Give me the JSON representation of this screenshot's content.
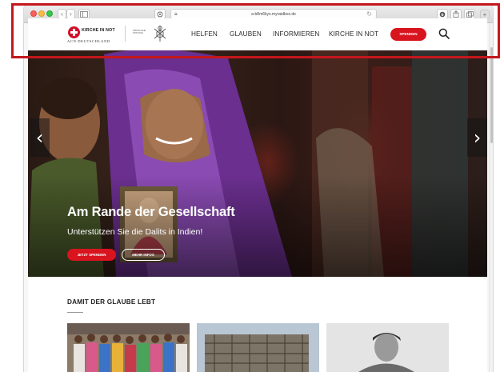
{
  "browser": {
    "address_url": "a-b8m6kys.myraidbox.de",
    "icons": [
      "back-icon",
      "forward-icon",
      "sidebar-icon",
      "privacy-icon",
      "reload-icon",
      "download-icon",
      "share-icon",
      "tabs-icon",
      "add-tab-icon"
    ]
  },
  "header": {
    "logo_name": "KIRCHE IN NOT",
    "logo_sub": "ACN DEUTSCHLAND",
    "pontif_text": "PÄPSTLICHE STIFTUNG",
    "nav": [
      "HELFEN",
      "GLAUBEN",
      "INFORMIEREN",
      "KIRCHE IN NOT"
    ],
    "donate_label": "SPENDEN"
  },
  "hero": {
    "title": "Am Rande der Gesellschaft",
    "subtitle": "Unterstützen Sie die Dalits in Indien!",
    "primary_cta": "JETZT SPENDEN",
    "secondary_cta": "MEHR INFOS",
    "prev_glyph": "‹",
    "next_glyph": "›"
  },
  "section": {
    "heading": "DAMIT DER GLAUBE LEBT"
  },
  "colors": {
    "brand_red": "#d8141f",
    "highlight": "#c4171c",
    "text_dark": "#2b2b2b"
  }
}
